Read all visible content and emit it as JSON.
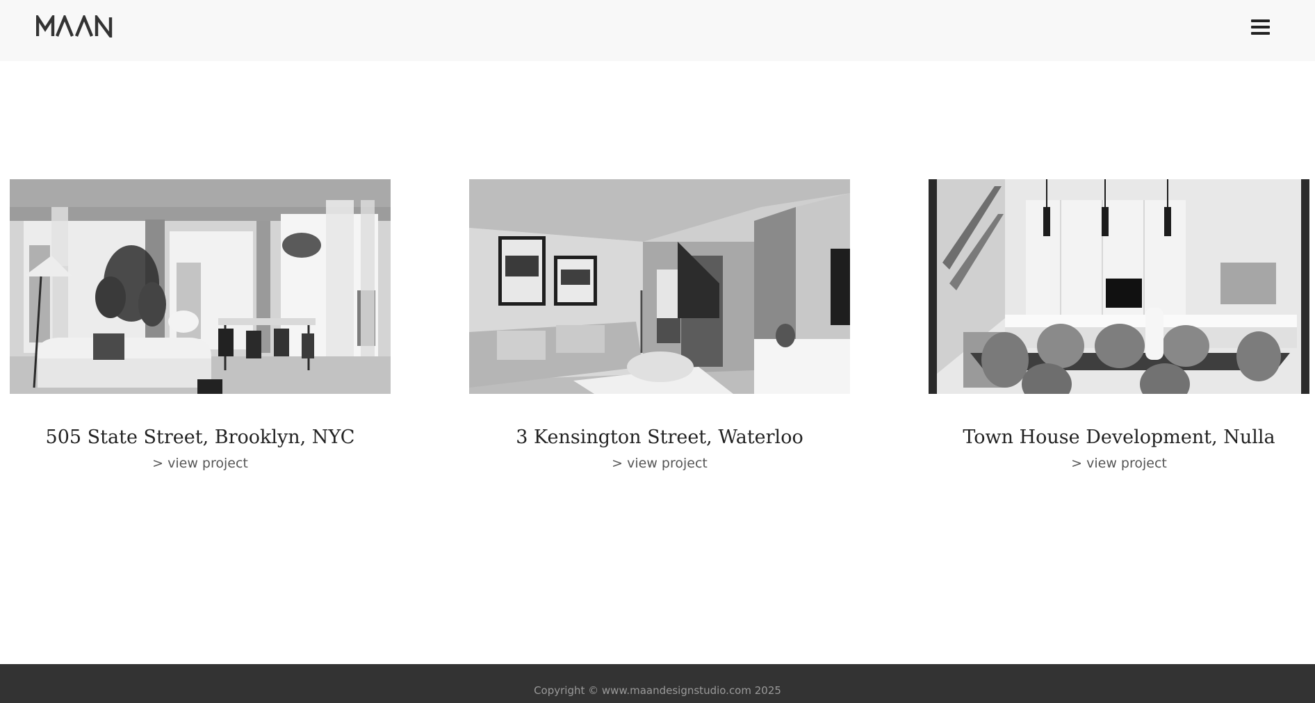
{
  "header": {
    "logo_text": "MAAN",
    "menu_icon": "hamburger-menu-icon"
  },
  "projects": [
    {
      "title": "505 State Street, Brooklyn, NYC",
      "link_label": "> view project"
    },
    {
      "title": "3 Kensington Street, Waterloo",
      "link_label": "> view project"
    },
    {
      "title": "Town House Development, Nulla",
      "link_label": "> view project"
    }
  ],
  "footer": {
    "copyright": "Copyright © www.maandesignstudio.com 2025"
  },
  "colors": {
    "header_bg": "#f8f8f8",
    "footer_bg": "#333333",
    "text_dark": "#222222",
    "link_grey": "#555555"
  }
}
